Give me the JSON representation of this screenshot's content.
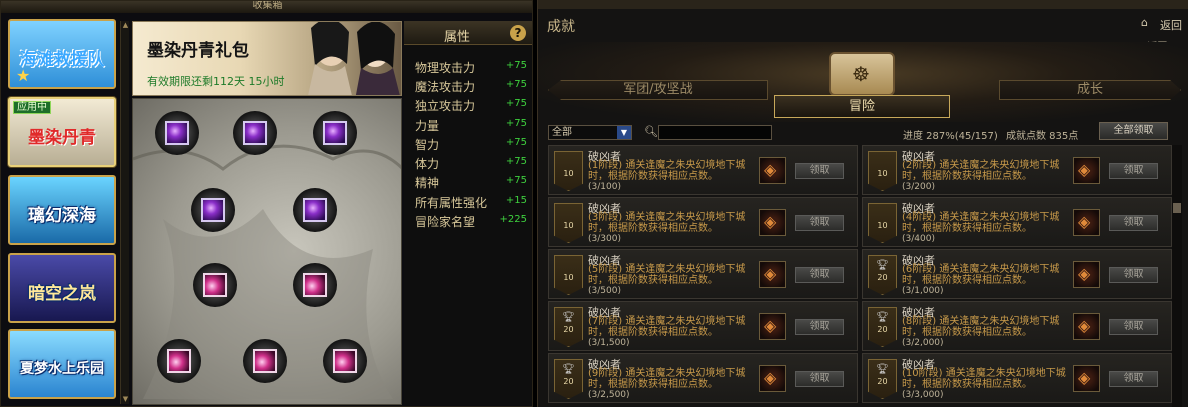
{
  "collection": {
    "window_title": "收集箱",
    "cards": [
      {
        "label": "海滩救援队",
        "badge": ""
      },
      {
        "label": "墨染丹青",
        "badge": "应用中"
      },
      {
        "label": "璃幻深海",
        "badge": ""
      },
      {
        "label": "暗空之岚",
        "badge": ""
      },
      {
        "label": "夏梦水上乐园",
        "badge": ""
      }
    ],
    "banner": {
      "title": "墨染丹青礼包",
      "timer": "有效期限还剩112天 15小时"
    },
    "attributes": {
      "title": "属性",
      "help": "?",
      "rows": [
        {
          "name": "物理攻击力",
          "value": "+75"
        },
        {
          "name": "魔法攻击力",
          "value": "+75"
        },
        {
          "name": "独立攻击力",
          "value": "+75"
        },
        {
          "name": "力量",
          "value": "+75"
        },
        {
          "name": "智力",
          "value": "+75"
        },
        {
          "name": "体力",
          "value": "+75"
        },
        {
          "name": "精神",
          "value": "+75"
        },
        {
          "name": "所有属性强化",
          "value": "+15"
        },
        {
          "name": "冒险家名望",
          "value": "+225"
        }
      ]
    }
  },
  "achievements": {
    "title": "成就",
    "back_label": "返回",
    "back2_label": "返回",
    "tabs": {
      "left": "军团/攻坚战",
      "center": "冒险",
      "right": "成长"
    },
    "filter": {
      "value": "全部"
    },
    "progress": "进度 287%(45/157)",
    "points": "成就点数 835点",
    "claim_all": "全部领取",
    "items": [
      {
        "name": "破凶者",
        "desc": "(1阶段) 通关逢魔之朱央幻境地下城时，根据阶数获得相应点数。",
        "progress": "(3/100)",
        "badge": "10",
        "cup": false,
        "btn": "领取"
      },
      {
        "name": "破凶者",
        "desc": "(2阶段) 通关逢魔之朱央幻境地下城时，根据阶数获得相应点数。",
        "progress": "(3/200)",
        "badge": "10",
        "cup": false,
        "btn": "领取"
      },
      {
        "name": "破凶者",
        "desc": "(3阶段) 通关逢魔之朱央幻境地下城时，根据阶数获得相应点数。",
        "progress": "(3/300)",
        "badge": "10",
        "cup": false,
        "btn": "领取"
      },
      {
        "name": "破凶者",
        "desc": "(4阶段) 通关逢魔之朱央幻境地下城时，根据阶数获得相应点数。",
        "progress": "(3/400)",
        "badge": "10",
        "cup": false,
        "btn": "领取"
      },
      {
        "name": "破凶者",
        "desc": "(5阶段) 通关逢魔之朱央幻境地下城时，根据阶数获得相应点数。",
        "progress": "(3/500)",
        "badge": "10",
        "cup": false,
        "btn": "领取"
      },
      {
        "name": "破凶者",
        "desc": "(6阶段) 通关逢魔之朱央幻境地下城时，根据阶数获得相应点数。",
        "progress": "(3/1,000)",
        "badge": "20",
        "cup": true,
        "btn": "领取"
      },
      {
        "name": "破凶者",
        "desc": "(7阶段) 通关逢魔之朱央幻境地下城时，根据阶数获得相应点数。",
        "progress": "(3/1,500)",
        "badge": "20",
        "cup": true,
        "btn": "领取"
      },
      {
        "name": "破凶者",
        "desc": "(8阶段) 通关逢魔之朱央幻境地下城时，根据阶数获得相应点数。",
        "progress": "(3/2,000)",
        "badge": "20",
        "cup": true,
        "btn": "领取"
      },
      {
        "name": "破凶者",
        "desc": "(9阶段) 通关逢魔之朱央幻境地下城时，根据阶数获得相应点数。",
        "progress": "(3/2,500)",
        "badge": "20",
        "cup": true,
        "btn": "领取"
      },
      {
        "name": "破凶者",
        "desc": "(10阶段) 通关逢魔之朱央幻境地下城时，根据阶数获得相应点数。",
        "progress": "(3/3,000)",
        "badge": "20",
        "cup": true,
        "btn": "领取"
      }
    ]
  }
}
